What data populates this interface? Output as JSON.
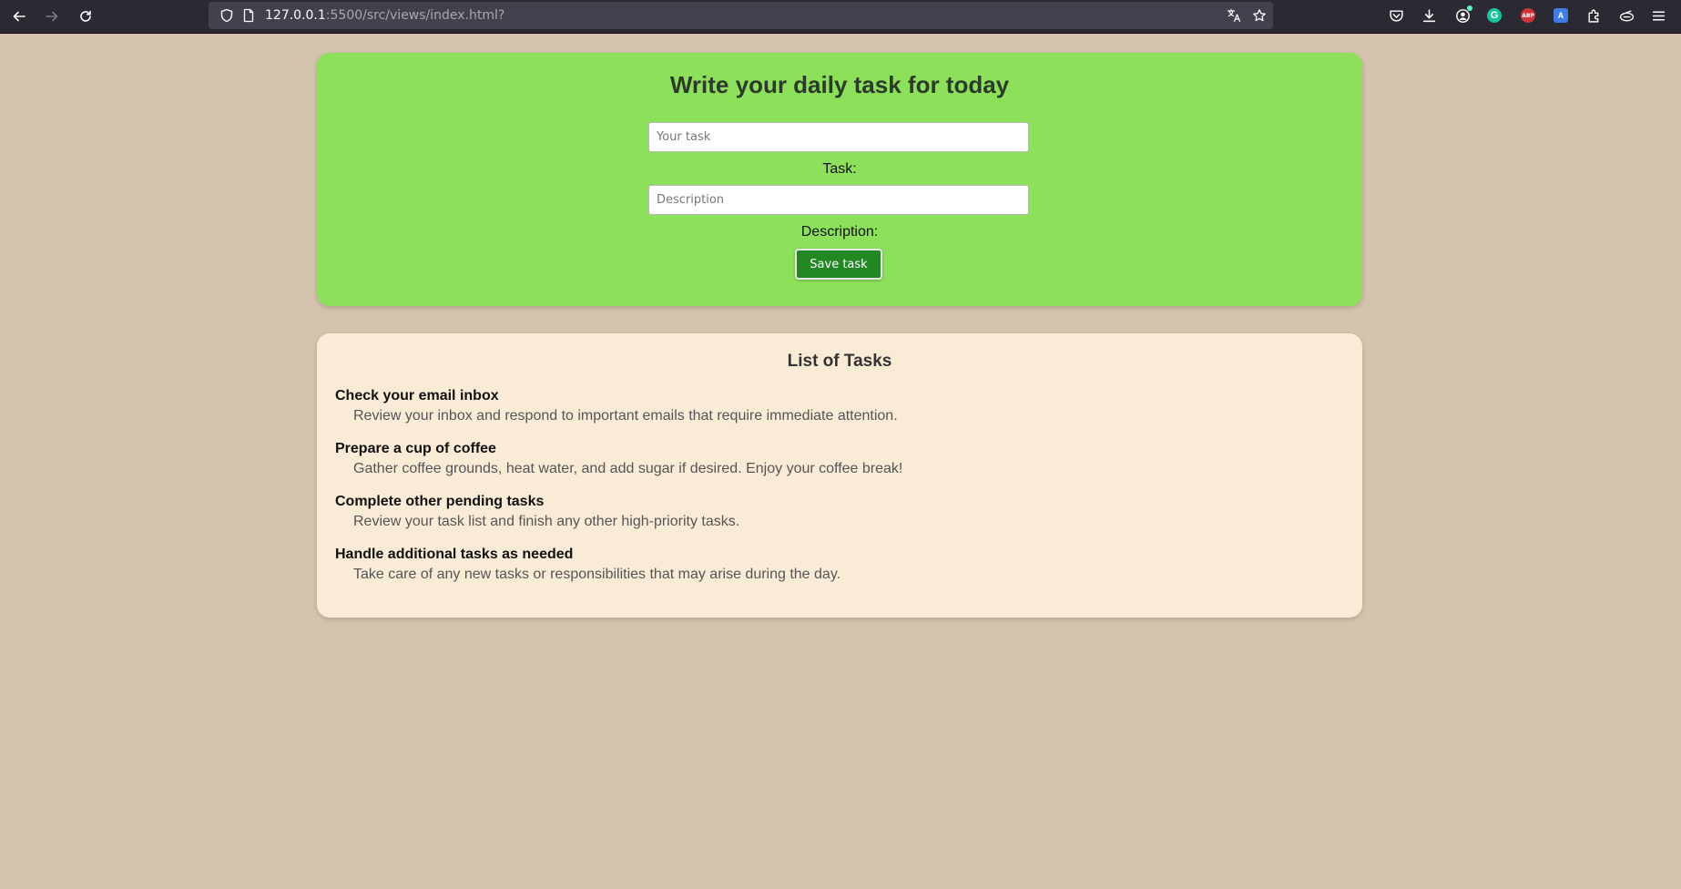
{
  "browser": {
    "url_host": "127.0.0.1",
    "url_rest": ":5500/src/views/index.html?",
    "extensions": {
      "abp_label": "ABP",
      "grammarly_label": "G",
      "translate_label": "A"
    }
  },
  "form": {
    "title": "Write your daily task for today",
    "task_placeholder": "Your task",
    "task_label": "Task:",
    "description_placeholder": "Description",
    "description_label": "Description:",
    "save_label": "Save task",
    "background_color": "#8de15a",
    "button_color": "#238823"
  },
  "list": {
    "title": "List of Tasks",
    "background_color": "#faebd7",
    "items": [
      {
        "title": "Check your email inbox",
        "description": "Review your inbox and respond to important emails that require immediate attention."
      },
      {
        "title": "Prepare a cup of coffee",
        "description": "Gather coffee grounds, heat water, and add sugar if desired. Enjoy your coffee break!"
      },
      {
        "title": "Complete other pending tasks",
        "description": "Review your task list and finish any other high-priority tasks."
      },
      {
        "title": "Handle additional tasks as needed",
        "description": "Take care of any new tasks or responsibilities that may arise during the day."
      }
    ]
  }
}
